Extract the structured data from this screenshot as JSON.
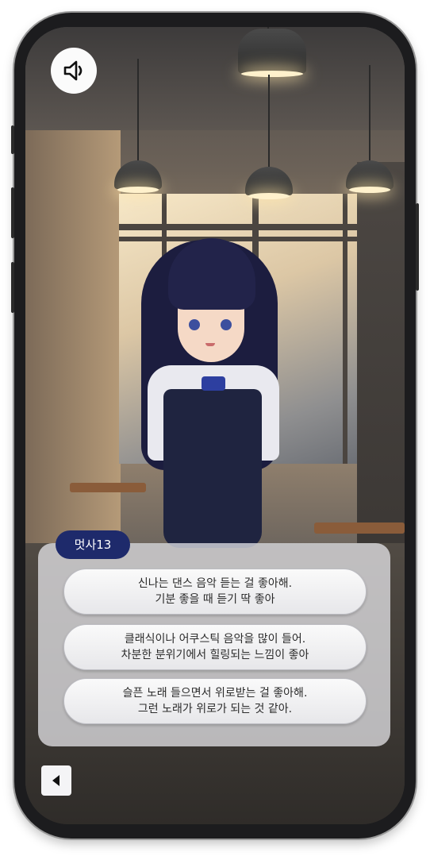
{
  "game": {
    "sound_icon": "speaker-icon",
    "speaker": {
      "name": "멋사13"
    },
    "choices": [
      {
        "line1": "신나는 댄스 음악 듣는 걸 좋아해.",
        "line2": "기분 좋을 때 듣기 딱 좋아"
      },
      {
        "line1": "클래식이나 어쿠스틱 음악을 많이 들어.",
        "line2": "차분한 분위기에서 힐링되는 느낌이 좋아"
      },
      {
        "line1": "슬픈 노래 들으면서 위로받는 걸 좋아해.",
        "line2": "그런 노래가 위로가 되는 것 같아."
      }
    ],
    "back_icon": "back-arrow-icon",
    "colors": {
      "name_tag": "#1e2a6b",
      "panel": "#ebecf0"
    }
  }
}
